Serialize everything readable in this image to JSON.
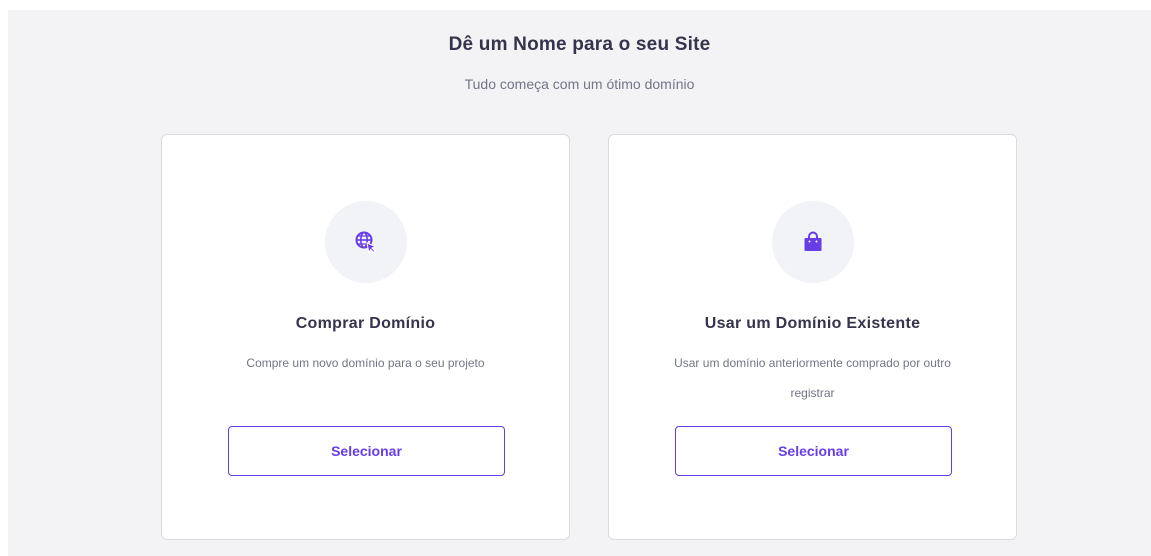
{
  "header": {
    "title": "Dê um Nome para o seu Site",
    "subtitle": "Tudo começa com um ótimo domínio"
  },
  "options": [
    {
      "icon": "globe-cursor-icon",
      "title": "Comprar Domínio",
      "description": "Compre um novo domínio para o seu projeto",
      "button_label": "Selecionar"
    },
    {
      "icon": "shopping-bag-icon",
      "title": "Usar um Domínio Existente",
      "description": "Usar um domínio anteriormente comprado por outro registrar",
      "button_label": "Selecionar"
    }
  ],
  "colors": {
    "accent": "#673de6",
    "panel_background": "#f3f3f6",
    "text_primary": "#36344d",
    "text_secondary": "#727586"
  }
}
